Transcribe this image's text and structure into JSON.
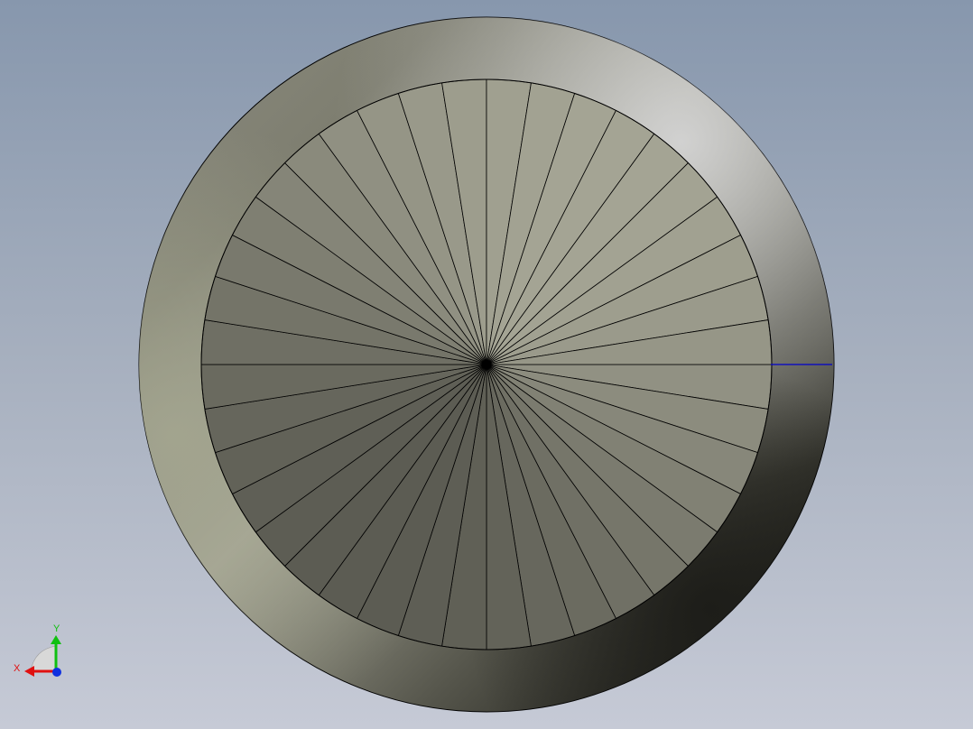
{
  "viewport": {
    "background_top": "#8797ad",
    "background_bottom": "#c6cad6"
  },
  "model": {
    "shape": "cone-with-ring",
    "outer_ring_face_color": "#9a9a88",
    "inner_face_color": "#8a8a7a",
    "edge_color": "#000000",
    "facet_count": 40,
    "highlight_edge_color": "#0000cc"
  },
  "triad": {
    "x_label": "X",
    "y_label": "Y",
    "x_color": "#e01010",
    "y_color": "#10c010",
    "z_color": "#1030e0"
  }
}
